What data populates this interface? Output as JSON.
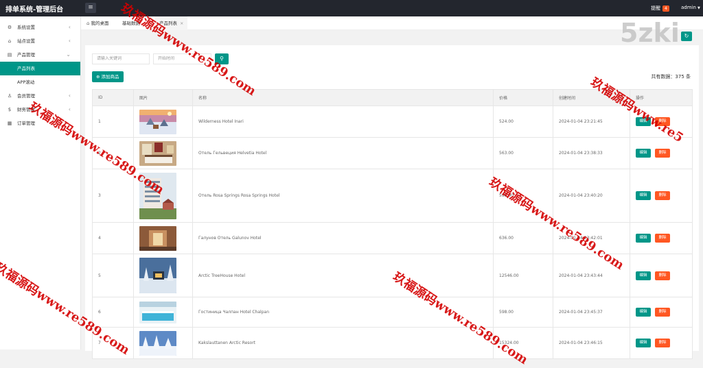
{
  "topbar": {
    "title": "排单系统-管理后台",
    "menu_icon": "menu-icon",
    "notice_label": "提醒",
    "notice_count": "4",
    "user": "admin"
  },
  "sidebar": {
    "items": [
      {
        "label": "系统设置",
        "icon": "gear-icon",
        "arrow": "‹"
      },
      {
        "label": "站点设置",
        "icon": "home-icon",
        "arrow": "‹"
      },
      {
        "label": "产品管理",
        "icon": "box-icon",
        "arrow": "⌄"
      },
      {
        "label": "产品列表",
        "icon": "",
        "arrow": ""
      },
      {
        "label": "APP滚动",
        "icon": "",
        "arrow": ""
      },
      {
        "label": "会员管理",
        "icon": "user-icon",
        "arrow": "‹"
      },
      {
        "label": "财务管理",
        "icon": "dollar-icon",
        "arrow": "‹"
      },
      {
        "label": "订单管理",
        "icon": "order-icon",
        "arrow": ""
      }
    ]
  },
  "tabs": {
    "home": "我的桌面",
    "basic": "基础数据",
    "active": "产品列表",
    "close": "×"
  },
  "toolbar": {
    "keyword_placeholder": "请输入关键词",
    "start_time_placeholder": "开始时间",
    "add_label": "添加商品",
    "total_text": "共有数据：375 条"
  },
  "table": {
    "headers": [
      "ID",
      "图片",
      "名称",
      "价格",
      "创建时间",
      "操作"
    ],
    "edit_label": "编辑",
    "delete_label": "删除",
    "rows": [
      {
        "id": "1",
        "name": "Wilderness Hotel Inari",
        "price": "524.00",
        "created": "2024-01-04 23:21:45",
        "image": "snow-village-photo"
      },
      {
        "id": "2",
        "name": "Отель Гельвеция Helvetia Hotel",
        "price": "563.00",
        "created": "2024-01-04 23:38:33",
        "image": "hotel-room-photo"
      },
      {
        "id": "3",
        "name": "Отель Rosa Springs Rosa Springs Hotel",
        "price": "598.00",
        "created": "2024-01-04 23:40:20",
        "image": "hotel-building-photo"
      },
      {
        "id": "4",
        "name": "Галунов Отель Galunov Hotel",
        "price": "636.00",
        "created": "2024-01-04 23:42:01",
        "image": "hotel-corridor-photo"
      },
      {
        "id": "5",
        "name": "Arctic TreeHouse Hotel",
        "price": "12546.00",
        "created": "2024-01-04 23:43:44",
        "image": "treehouse-photo"
      },
      {
        "id": "6",
        "name": "Гостиница Чалпан Hotel Chalpan",
        "price": "598.00",
        "created": "2024-01-04 23:45:37",
        "image": "pool-photo"
      },
      {
        "id": "7",
        "name": "Kakslauttanen Arctic Resort",
        "price": "15324.00",
        "created": "2024-01-04 23:46:15",
        "image": "arctic-resort-photo"
      }
    ]
  },
  "watermarks": {
    "brand": "5zki",
    "text_a": "玖福源码www.re589.com",
    "text_b": "玖福源码www.re5"
  },
  "colors": {
    "accent": "#009688",
    "danger": "#ff5722",
    "topbar": "#23262e",
    "watermark": "#d40000"
  }
}
